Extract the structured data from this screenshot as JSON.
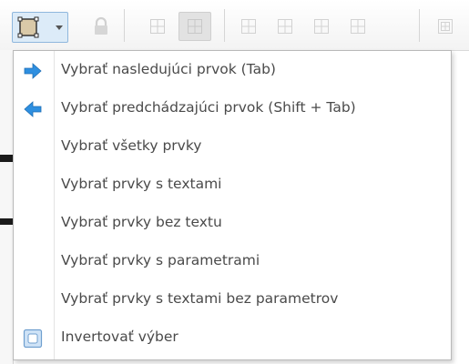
{
  "toolbar": {
    "buttons": [
      {
        "name": "selection-dropdown",
        "icon": "selection-rectangle-icon"
      },
      {
        "name": "lock",
        "icon": "lock-icon"
      },
      {
        "name": "grid-a",
        "icon": "grid-icon"
      },
      {
        "name": "grid-b",
        "icon": "grid-icon"
      },
      {
        "name": "grid-c",
        "icon": "grid-icon"
      },
      {
        "name": "grid-d",
        "icon": "grid-icon"
      },
      {
        "name": "grid-e",
        "icon": "grid-icon"
      },
      {
        "name": "grid-f",
        "icon": "grid-icon"
      },
      {
        "name": "grid-g",
        "icon": "grid-icon"
      }
    ]
  },
  "menu": {
    "items": [
      {
        "label": "Vybrať nasledujúci prvok (Tab)",
        "icon": "arrow-right-icon"
      },
      {
        "label": "Vybrať predchádzajúci prvok (Shift + Tab)",
        "icon": "arrow-left-icon"
      },
      {
        "label": "Vybrať všetky prvky",
        "icon": ""
      },
      {
        "label": "Vybrať prvky s textami",
        "icon": ""
      },
      {
        "label": "Vybrať prvky bez textu",
        "icon": ""
      },
      {
        "label": "Vybrať prvky s parametrami",
        "icon": ""
      },
      {
        "label": "Vybrať prvky s textami bez parametrov",
        "icon": ""
      },
      {
        "label": "Invertovať výber",
        "icon": "invert-selection-icon"
      }
    ]
  },
  "colors": {
    "arrow_blue": "#2e8fe0",
    "menu_text": "#4a4a4a",
    "dropdown_highlight": "#dcebf8"
  }
}
